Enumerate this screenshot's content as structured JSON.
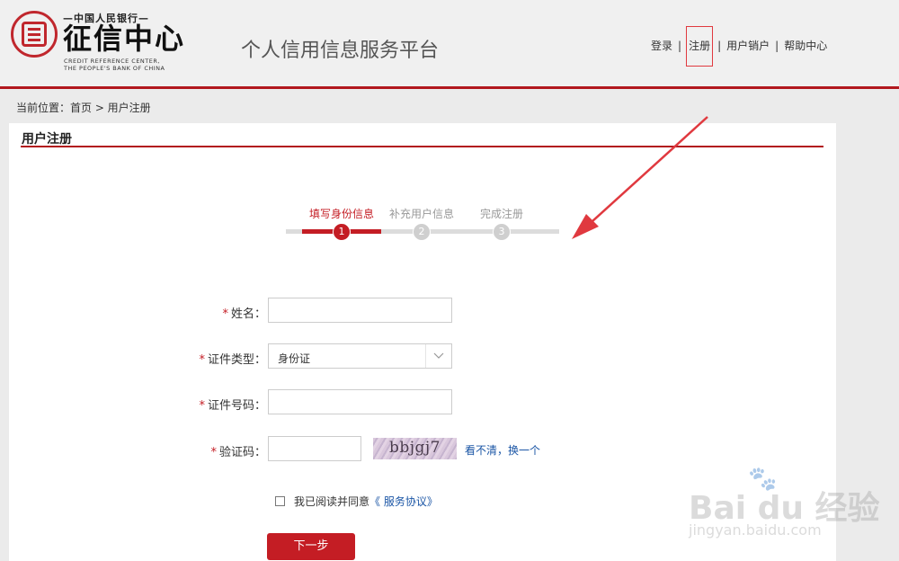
{
  "header": {
    "logo_top": "—中国人民银行—",
    "logo_main": "征信中心",
    "logo_en_line1": "CREDIT REFERENCE CENTER,",
    "logo_en_line2": "THE PEOPLE'S BANK OF CHINA",
    "site_title": "个人信用信息服务平台",
    "nav": [
      "登录",
      "注册",
      "用户销户",
      "帮助中心"
    ],
    "nav_sep": "|"
  },
  "breadcrumb": "当前位置：首页 > 用户注册",
  "panel_title": "用户注册",
  "steps": [
    {
      "label": "填写身份信息",
      "num": "1"
    },
    {
      "label": "补充用户信息",
      "num": "2"
    },
    {
      "label": "完成注册",
      "num": "3"
    }
  ],
  "form": {
    "required_mark": "*",
    "name_label": "姓名：",
    "id_type_label": "证件类型：",
    "id_type_value": "身份证",
    "id_number_label": "证件号码：",
    "captcha_label": "验证码：",
    "captcha_text": "bbjgj7",
    "refresh_link": "看不清，换一个",
    "agree_text": "我已阅读并同意",
    "agree_link": "《 服务协议》",
    "next_button": "下一步"
  },
  "watermark": {
    "text": "Bai du 经验",
    "url": "jingyan.baidu.com"
  },
  "colors": {
    "brand_red": "#c41d24",
    "link_blue": "#1a55a5",
    "header_bg": "#f0f0f0"
  }
}
